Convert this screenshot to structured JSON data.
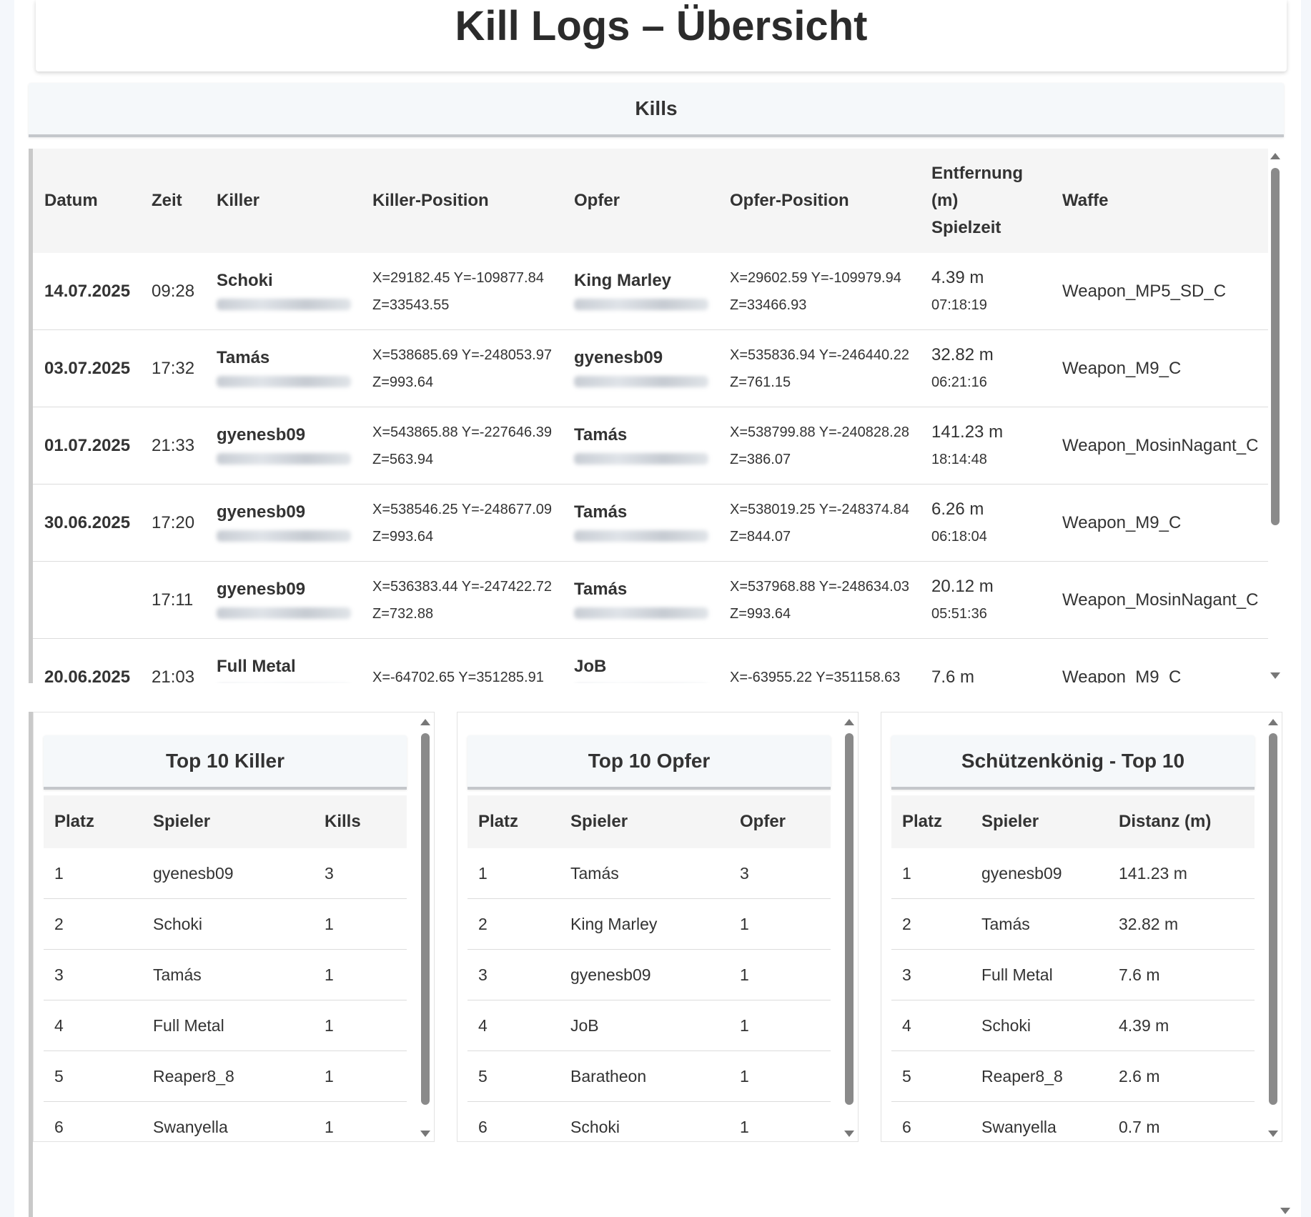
{
  "page_title": "Kill Logs – Übersicht",
  "kills": {
    "title": "Kills",
    "headers": {
      "date": "Datum",
      "time": "Zeit",
      "killer": "Killer",
      "killer_pos": "Killer-Position",
      "victim": "Opfer",
      "victim_pos": "Opfer-Position",
      "dist1": "Entfernung",
      "dist2": "(m)",
      "dist3": "Spielzeit",
      "weapon": "Waffe"
    },
    "rows": [
      {
        "date": "14.07.2025",
        "time": "09:28",
        "killer": "Schoki",
        "killer_pos1": "X=29182.45 Y=-109877.84",
        "killer_pos2": "Z=33543.55",
        "victim": "King Marley",
        "victim_pos1": "X=29602.59 Y=-109979.94",
        "victim_pos2": "Z=33466.93",
        "distance": "4.39 m",
        "playtime": "07:18:19",
        "weapon": "Weapon_MP5_SD_C"
      },
      {
        "date": "03.07.2025",
        "time": "17:32",
        "killer": "Tamás",
        "killer_pos1": "X=538685.69 Y=-248053.97",
        "killer_pos2": "Z=993.64",
        "victim": "gyenesb09",
        "victim_pos1": "X=535836.94 Y=-246440.22",
        "victim_pos2": "Z=761.15",
        "distance": "32.82 m",
        "playtime": "06:21:16",
        "weapon": "Weapon_M9_C"
      },
      {
        "date": "01.07.2025",
        "time": "21:33",
        "killer": "gyenesb09",
        "killer_pos1": "X=543865.88 Y=-227646.39",
        "killer_pos2": "Z=563.94",
        "victim": "Tamás",
        "victim_pos1": "X=538799.88 Y=-240828.28",
        "victim_pos2": "Z=386.07",
        "distance": "141.23 m",
        "playtime": "18:14:48",
        "weapon": "Weapon_MosinNagant_C"
      },
      {
        "date": "30.06.2025",
        "time": "17:20",
        "killer": "gyenesb09",
        "killer_pos1": "X=538546.25 Y=-248677.09",
        "killer_pos2": "Z=993.64",
        "victim": "Tamás",
        "victim_pos1": "X=538019.25 Y=-248374.84",
        "victim_pos2": "Z=844.07",
        "distance": "6.26 m",
        "playtime": "06:18:04",
        "weapon": "Weapon_M9_C"
      },
      {
        "date": "",
        "time": "17:11",
        "killer": "gyenesb09",
        "killer_pos1": "X=536383.44 Y=-247422.72",
        "killer_pos2": "Z=732.88",
        "victim": "Tamás",
        "victim_pos1": "X=537968.88 Y=-248634.03",
        "victim_pos2": "Z=993.64",
        "distance": "20.12 m",
        "playtime": "05:51:36",
        "weapon": "Weapon_MosinNagant_C"
      },
      {
        "date": "20.06.2025",
        "time": "21:03",
        "killer": "Full Metal",
        "killer_pos1": "X=-64702.65 Y=351285.91",
        "killer_pos2": "",
        "victim": "JoB",
        "victim_pos1": "X=-63955.22 Y=351158.63",
        "victim_pos2": "",
        "distance": "7.6 m",
        "playtime": "",
        "weapon": "Weapon_M9_C"
      }
    ]
  },
  "top_killer": {
    "title": "Top 10 Killer",
    "headers": [
      "Platz",
      "Spieler",
      "Kills"
    ],
    "rows": [
      [
        "1",
        "gyenesb09",
        "3"
      ],
      [
        "2",
        "Schoki",
        "1"
      ],
      [
        "3",
        "Tamás",
        "1"
      ],
      [
        "4",
        "Full Metal",
        "1"
      ],
      [
        "5",
        "Reaper8_8",
        "1"
      ],
      [
        "6",
        "Swanyella",
        "1"
      ]
    ]
  },
  "top_opfer": {
    "title": "Top 10 Opfer",
    "headers": [
      "Platz",
      "Spieler",
      "Opfer"
    ],
    "rows": [
      [
        "1",
        "Tamás",
        "3"
      ],
      [
        "2",
        "King Marley",
        "1"
      ],
      [
        "3",
        "gyenesb09",
        "1"
      ],
      [
        "4",
        "JoB",
        "1"
      ],
      [
        "5",
        "Baratheon",
        "1"
      ],
      [
        "6",
        "Schoki",
        "1"
      ]
    ]
  },
  "top_schuetzen": {
    "title": "Schützenkönig - Top 10",
    "headers": [
      "Platz",
      "Spieler",
      "Distanz (m)"
    ],
    "rows": [
      [
        "1",
        "gyenesb09",
        "141.23 m"
      ],
      [
        "2",
        "Tamás",
        "32.82 m"
      ],
      [
        "3",
        "Full Metal",
        "7.6 m"
      ],
      [
        "4",
        "Schoki",
        "4.39 m"
      ],
      [
        "5",
        "Reaper8_8",
        "2.6 m"
      ],
      [
        "6",
        "Swanyella",
        "0.7 m"
      ]
    ]
  }
}
